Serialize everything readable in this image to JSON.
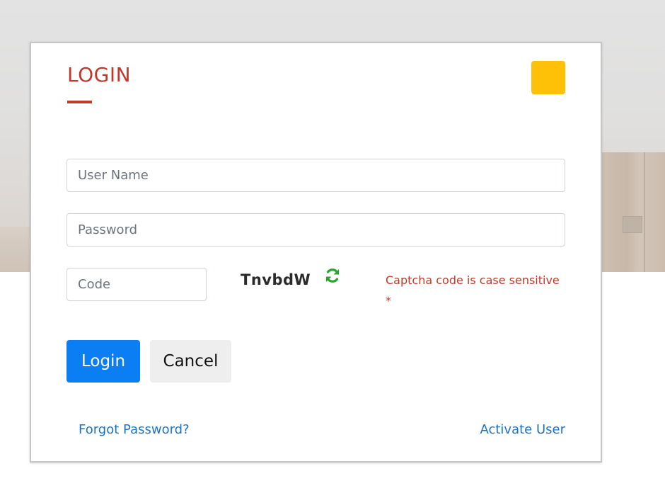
{
  "login_card": {
    "title": "LOGIN",
    "username": {
      "placeholder": "User Name",
      "value": ""
    },
    "password": {
      "placeholder": "Password",
      "value": ""
    },
    "code": {
      "placeholder": "Code",
      "value": ""
    },
    "captcha": {
      "text": "TnvbdW",
      "refresh_icon": "refresh-icon",
      "note": "Captcha code is case sensitive",
      "required_marker": "*"
    },
    "buttons": {
      "login": "Login",
      "cancel": "Cancel"
    },
    "links": {
      "forgot_password": "Forgot Password?",
      "activate_user": "Activate User"
    }
  },
  "colors": {
    "title_red": "#c0392b",
    "logo_yellow": "#ffc107",
    "primary_blue": "#0b7ef3",
    "link_blue": "#1a73c9"
  }
}
